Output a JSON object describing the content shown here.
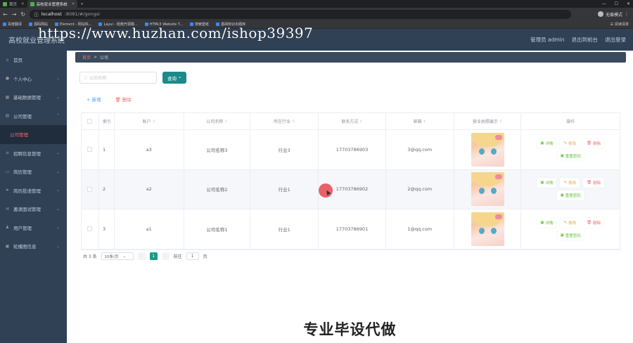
{
  "browser": {
    "tabs": [
      {
        "label": "首页"
      },
      {
        "label": "高校就业管理系统"
      }
    ],
    "url_host": "localhost",
    "url_path": ":8081/#/gongsi",
    "profile_label": "无痕模式",
    "bookmarks": [
      "百度翻译",
      "源码网站",
      "Element - 网站快...",
      "Layui - 经典开源模...",
      "HTML5 Website T...",
      "搜索壁纸",
      "基础知识出题库"
    ],
    "bookmarks_right": "阅读清单"
  },
  "header": {
    "app_title": "高校就业管理系统",
    "watermark": "https://www.huzhan.com/ishop39397",
    "links": [
      "管理员 admin",
      "退出到前台",
      "退出登录"
    ]
  },
  "sidebar": {
    "items": [
      {
        "label": "首页",
        "icon": "home-icon",
        "arrow": false
      },
      {
        "label": "个人中心",
        "icon": "user-icon",
        "arrow": true
      },
      {
        "label": "基础数据管理",
        "icon": "grid-icon",
        "arrow": true
      },
      {
        "label": "公司管理",
        "icon": "building-icon",
        "arrow": true,
        "open": true
      },
      {
        "label": "公司管理",
        "sub": true
      },
      {
        "label": "招聘信息管理",
        "icon": "list-icon",
        "arrow": true
      },
      {
        "label": "简历管理",
        "icon": "doc-icon",
        "arrow": true
      },
      {
        "label": "简历投递管理",
        "icon": "send-icon",
        "arrow": true
      },
      {
        "label": "邀请面试管理",
        "icon": "mail-icon",
        "arrow": true
      },
      {
        "label": "用户管理",
        "icon": "users-icon",
        "arrow": true
      },
      {
        "label": "轮播图信息",
        "icon": "image-icon",
        "arrow": true
      }
    ]
  },
  "breadcrumb": {
    "home": "首页",
    "sep": ">",
    "current": "公司"
  },
  "search": {
    "placeholder": "公司名称",
    "button": "查询"
  },
  "actions": {
    "add": "新增",
    "delete": "删除"
  },
  "table": {
    "headers": [
      "索引",
      "账户",
      "公司名称",
      "所在行业",
      "联系方式",
      "邮箱",
      "营业执照展示",
      "操作"
    ],
    "rows": [
      {
        "index": "1",
        "account": "a3",
        "name": "公司名称3",
        "industry": "行业3",
        "phone": "17703786903",
        "email": "3@qq.com"
      },
      {
        "index": "2",
        "account": "a2",
        "name": "公司名称2",
        "industry": "行业1",
        "phone": "17703786902",
        "email": "2@qq.com"
      },
      {
        "index": "3",
        "account": "a1",
        "name": "公司名称1",
        "industry": "行业1",
        "phone": "17703786901",
        "email": "1@qq.com"
      }
    ],
    "ops": {
      "detail": "详情",
      "edit": "修改",
      "delete": "删除",
      "reset": "重置密码"
    }
  },
  "pager": {
    "total": "共 3 条",
    "size": "10条/页",
    "current": "1",
    "goto_label": "前往",
    "goto_value": "1",
    "page_suffix": "页"
  },
  "banner": "专业毕设代做"
}
